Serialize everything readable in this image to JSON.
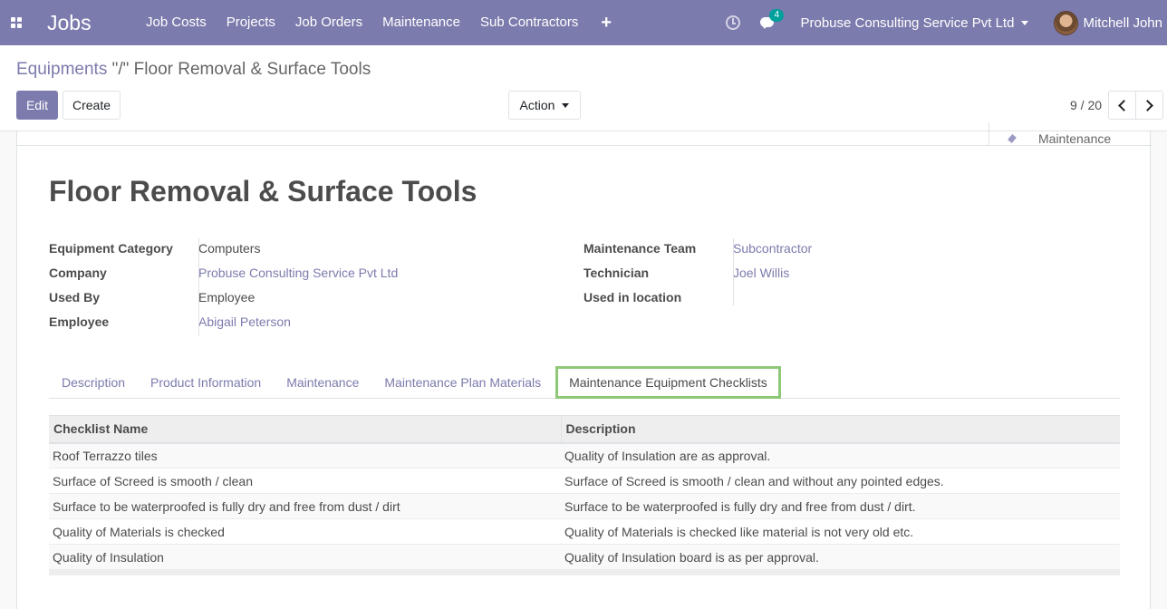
{
  "navbar": {
    "brand": "Jobs",
    "menu": [
      "Job Costs",
      "Projects",
      "Job Orders",
      "Maintenance",
      "Sub Contractors"
    ],
    "plus": "+",
    "chat_count": "4",
    "company": "Probuse Consulting Service Pvt Ltd",
    "user": "Mitchell John",
    "accent": "#7c7bad"
  },
  "breadcrumb": {
    "parent": "Equipments",
    "current": "\"/\" Floor Removal & Surface Tools"
  },
  "buttons": {
    "edit": "Edit",
    "create": "Create",
    "action": "Action"
  },
  "pager": {
    "value": "9 / 20"
  },
  "smart_button": {
    "label": "Maintenance"
  },
  "record": {
    "title": "Floor Removal & Surface Tools",
    "left": [
      {
        "label": "Equipment Category",
        "value": "Computers"
      },
      {
        "label": "Company",
        "value": "Probuse Consulting Service Pvt Ltd"
      },
      {
        "label": "Used By",
        "value": "Employee"
      },
      {
        "label": "Employee",
        "value": "Abigail Peterson"
      }
    ],
    "right": [
      {
        "label": "Maintenance Team",
        "value": "Subcontractor"
      },
      {
        "label": "Technician",
        "value": "Joel Willis"
      },
      {
        "label": "Used in location",
        "value": ""
      }
    ]
  },
  "tabs": [
    "Description",
    "Product Information",
    "Maintenance",
    "Maintenance Plan Materials",
    "Maintenance Equipment Checklists"
  ],
  "active_tab": "Maintenance Equipment Checklists",
  "checklist": {
    "columns": [
      "Checklist Name",
      "Description"
    ],
    "rows": [
      [
        "Roof Terrazzo tiles",
        "Quality of Insulation are as approval."
      ],
      [
        "Surface of Screed is smooth / clean",
        "Surface of Screed is smooth / clean and without any pointed edges."
      ],
      [
        "Surface to be waterproofed is fully dry and free from dust / dirt",
        "Surface to be waterproofed is fully dry and free from dust / dirt."
      ],
      [
        "Quality of Materials is checked",
        "Quality of Materials is checked like material is not very old etc."
      ],
      [
        "Quality of Insulation",
        "Quality of Insulation board is as per approval."
      ]
    ]
  }
}
